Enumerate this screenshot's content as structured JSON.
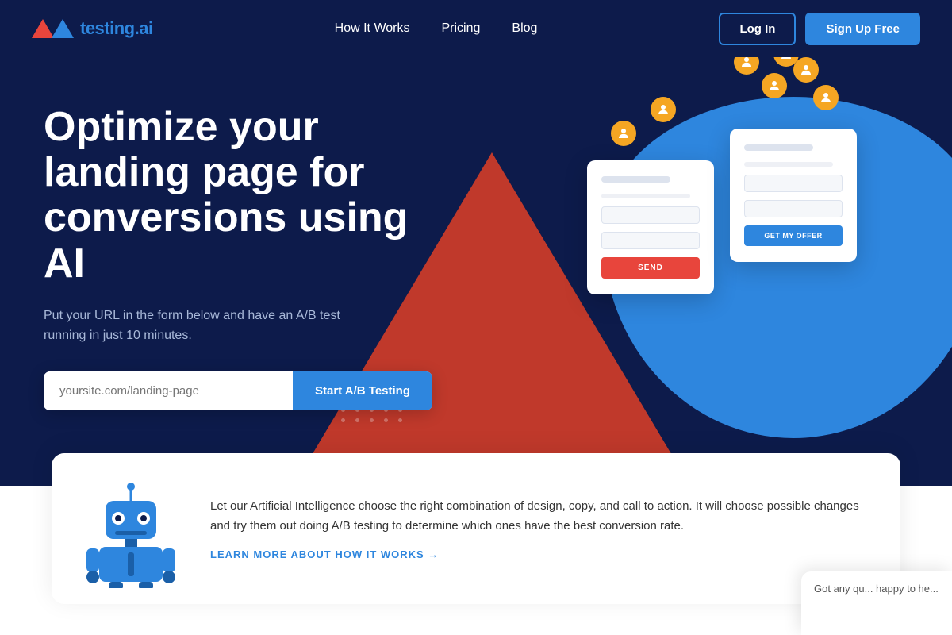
{
  "navbar": {
    "logo_text": "testing",
    "logo_dot_ai": ".ai",
    "nav_links": [
      {
        "id": "how-it-works",
        "label": "How It Works"
      },
      {
        "id": "pricing",
        "label": "Pricing"
      },
      {
        "id": "blog",
        "label": "Blog"
      }
    ],
    "login_label": "Log In",
    "signup_label": "Sign Up Free"
  },
  "hero": {
    "title": "Optimize your landing page for conversions using AI",
    "subtitle": "Put your URL in the form below and have an A/B test running in just 10 minutes.",
    "input_placeholder": "yoursite.com/landing-page",
    "cta_label": "Start A/B Testing"
  },
  "mockup1": {
    "button_label": "SEND"
  },
  "mockup2": {
    "button_label": "GET MY OFFER"
  },
  "bottom": {
    "description": "Let our Artificial Intelligence choose the right combination of design, copy, and call to action. It will choose possible changes and try them out doing A/B testing to determine which ones have the best conversion rate.",
    "learn_more_label": "LEARN MORE ABOUT HOW IT WORKS →"
  },
  "chat": {
    "text": "Got any qu... happy to he..."
  }
}
